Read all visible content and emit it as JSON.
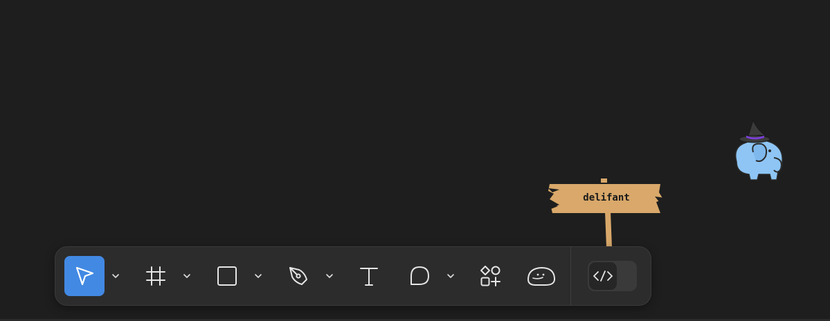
{
  "canvas": {
    "background": "#1e1e1e"
  },
  "sign": {
    "label": "delifant",
    "board_color": "#d9a86a",
    "post_color": "#d9a86a"
  },
  "mascot": {
    "icon": "elephant-witch-hat-icon",
    "body_color": "#8ec5f5",
    "hat_color": "#3b3b3b",
    "hat_band_color": "#7b3fd6"
  },
  "toolbar": {
    "accent": "#4289e3",
    "active_tool": "move",
    "tools": [
      {
        "id": "move",
        "icon": "cursor-arrow-icon",
        "has_menu": true
      },
      {
        "id": "frame",
        "icon": "hash-frame-icon",
        "has_menu": true
      },
      {
        "id": "shape",
        "icon": "rectangle-icon",
        "has_menu": true
      },
      {
        "id": "pen",
        "icon": "pen-nib-icon",
        "has_menu": true
      },
      {
        "id": "text",
        "icon": "text-t-icon",
        "has_menu": false
      },
      {
        "id": "comment",
        "icon": "comment-bubble-icon",
        "has_menu": true
      },
      {
        "id": "assets",
        "icon": "shapes-plus-icon",
        "has_menu": false
      },
      {
        "id": "actions",
        "icon": "blob-face-icon",
        "has_menu": false
      }
    ],
    "dev_mode": {
      "icon": "code-brackets-icon",
      "enabled": false
    }
  }
}
